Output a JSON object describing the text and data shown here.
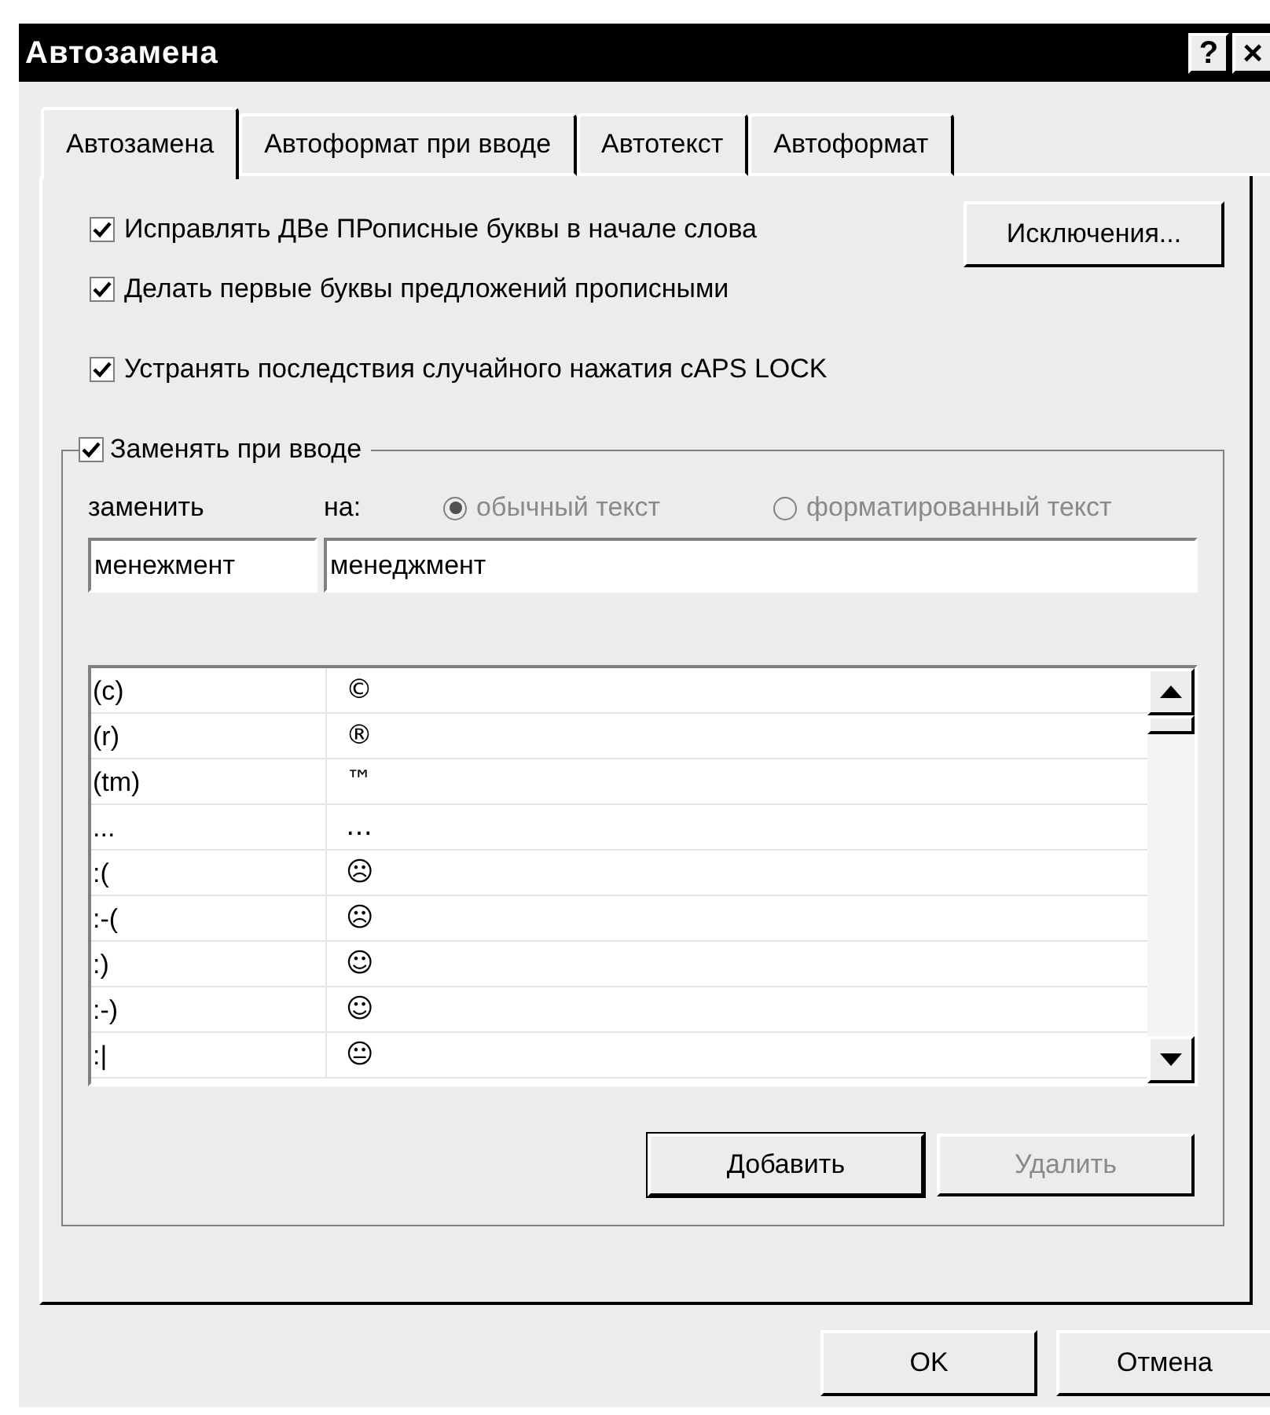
{
  "window": {
    "title": "Автозамена",
    "help_button": "?",
    "close_button": "×"
  },
  "tabs": [
    {
      "label": "Автозамена",
      "selected": true
    },
    {
      "label": "Автоформат при вводе",
      "selected": false
    },
    {
      "label": "Автотекст",
      "selected": false
    },
    {
      "label": "Автоформат",
      "selected": false
    }
  ],
  "options": [
    {
      "label": "Исправлять ДВе ПРописные буквы в начале слова",
      "checked": true
    },
    {
      "label": "Делать первые буквы предложений прописными",
      "checked": true
    },
    {
      "label": "Устранять последствия случайного нажатия cAPS LOCK",
      "checked": true
    }
  ],
  "exceptions_button": "Исключения...",
  "replace_group": {
    "label": "Заменять при вводе",
    "checked": true,
    "replace_label": "заменить",
    "with_label": "на:",
    "formats": [
      {
        "label": "обычный текст",
        "selected": true,
        "disabled": true
      },
      {
        "label": "форматированный текст",
        "selected": false,
        "disabled": true
      }
    ],
    "replace_value": "менежмент",
    "with_value": "менеджмент",
    "list": {
      "rows": [
        {
          "from": "(c)",
          "to": "©"
        },
        {
          "from": "(r)",
          "to": "®"
        },
        {
          "from": "(tm)",
          "to": "™"
        },
        {
          "from": "...",
          "to": "…"
        },
        {
          "from": ":(",
          "to": "☹"
        },
        {
          "from": ":-(",
          "to": "☹"
        },
        {
          "from": ":)",
          "to": "☺"
        },
        {
          "from": ":-)",
          "to": "☺"
        },
        {
          "from": ":|",
          "to": "😐"
        }
      ]
    },
    "add_button": {
      "label": "Добавить",
      "disabled": false
    },
    "delete_button": {
      "label": "Удалить",
      "disabled": true
    }
  },
  "buttons": [
    "OK",
    "Отмена"
  ]
}
